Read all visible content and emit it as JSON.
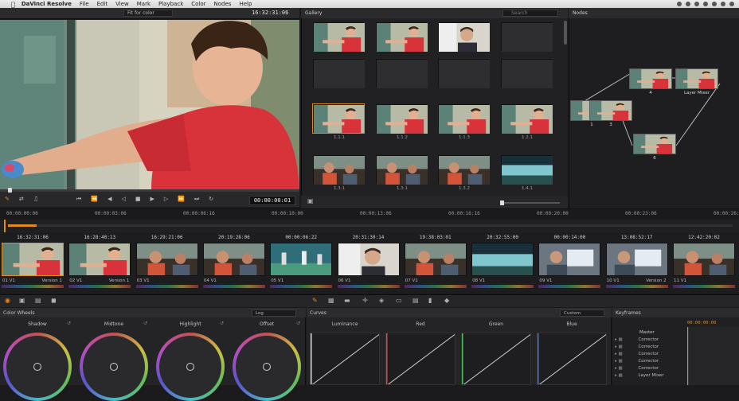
{
  "menubar": {
    "app": "DaVinci Resolve",
    "items": [
      "File",
      "Edit",
      "View",
      "Mark",
      "Playback",
      "Color",
      "Nodes",
      "Help"
    ]
  },
  "viewer": {
    "mode_select": "Fit for color",
    "timecode": "16:32:31:06",
    "current_tc": "00:00:00:01",
    "transport": [
      "first",
      "prev",
      "step-back",
      "stop",
      "play",
      "step-fwd",
      "next",
      "last",
      "loop"
    ]
  },
  "gallery": {
    "title": "Gallery",
    "search_placeholder": "Search",
    "rows": [
      [
        {
          "label": "",
          "kind": "kid"
        },
        {
          "label": "",
          "kind": "kid"
        },
        {
          "label": "",
          "kind": "man"
        },
        {
          "label": "",
          "kind": "empty"
        }
      ],
      [
        {
          "label": "",
          "kind": "empty"
        },
        {
          "label": "",
          "kind": "empty"
        },
        {
          "label": "",
          "kind": "empty"
        },
        {
          "label": "",
          "kind": "empty"
        }
      ],
      [
        {
          "label": "1.1.1",
          "kind": "kid",
          "selected": true
        },
        {
          "label": "1.1.2",
          "kind": "kid"
        },
        {
          "label": "1.1.3",
          "kind": "kid"
        },
        {
          "label": "1.2.1",
          "kind": "kid"
        }
      ],
      [
        {
          "label": "1.3.1",
          "kind": "room"
        },
        {
          "label": "1.3.1",
          "kind": "room"
        },
        {
          "label": "1.3.2",
          "kind": "room"
        },
        {
          "label": "1.4.1",
          "kind": "teal"
        }
      ]
    ]
  },
  "nodes": {
    "title": "Nodes",
    "items": [
      {
        "id": "n1",
        "label": "1"
      },
      {
        "id": "n2",
        "label": "3"
      },
      {
        "id": "n3",
        "label": "4"
      },
      {
        "id": "n4",
        "label": "Layer Mixer"
      },
      {
        "id": "n5",
        "label": "6"
      }
    ]
  },
  "ruler": {
    "ticks": [
      "00:00:00:00",
      "00:00:03:06",
      "00:00:06:16",
      "00:00:10:00",
      "00:00:13:06",
      "00:00:16:16",
      "00:00:20:00",
      "00:00:23:06",
      "00:00:26:1"
    ]
  },
  "clips": [
    {
      "tc": "16:32:31:06",
      "track": "01 V1",
      "name": "Version 1",
      "kind": "kid",
      "selected": true
    },
    {
      "tc": "16:28:40:13",
      "track": "02 V1",
      "name": "Version 1",
      "kind": "kid"
    },
    {
      "tc": "16:29:21:06",
      "track": "03 V1",
      "name": "",
      "kind": "room"
    },
    {
      "tc": "20:19:28:06",
      "track": "04 V1",
      "name": "",
      "kind": "room"
    },
    {
      "tc": "00:00:06:22",
      "track": "05 V1",
      "name": "",
      "kind": "sport"
    },
    {
      "tc": "20:31:30:14",
      "track": "06 V1",
      "name": "",
      "kind": "man"
    },
    {
      "tc": "19:38:03:01",
      "track": "07 V1",
      "name": "",
      "kind": "room"
    },
    {
      "tc": "20:32:55:00",
      "track": "08 V1",
      "name": "",
      "kind": "teal"
    },
    {
      "tc": "00:00:14:00",
      "track": "09 V1",
      "name": "",
      "kind": "office"
    },
    {
      "tc": "13:08:52:17",
      "track": "10 V1",
      "name": "Version 2",
      "kind": "office"
    },
    {
      "tc": "12:42:20:02",
      "track": "11 V1",
      "name": "",
      "kind": "room"
    }
  ],
  "color_wheels": {
    "title": "Color Wheels",
    "mode": "Log",
    "wheels": [
      "Shadow",
      "Midtone",
      "Highlight",
      "Offset"
    ]
  },
  "curves": {
    "title": "Curves",
    "mode": "Custom",
    "channels": [
      "Luminance",
      "Red",
      "Green",
      "Blue"
    ]
  },
  "keyframes": {
    "title": "Keyframes",
    "tc": "00:00:00:00",
    "master": "Master",
    "rows": [
      "Corrector",
      "Corrector",
      "Corrector",
      "Corrector",
      "Corrector",
      "Layer Mixer"
    ]
  },
  "colors": {
    "accent": "#e08a1e",
    "shirt": "#d8323a"
  }
}
